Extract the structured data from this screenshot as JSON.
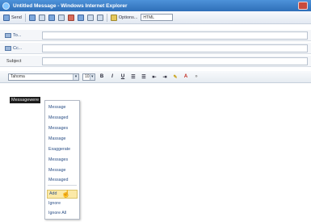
{
  "window": {
    "title": "Untitled Message - Windows Internet Explorer"
  },
  "toolbar": {
    "send_label": "Send",
    "options_label": "Options...",
    "format_value": "HTML"
  },
  "headers": {
    "to_label": "To...",
    "cc_label": "Cc...",
    "subject_label": "Subject"
  },
  "format_bar": {
    "font_value": "Tahoma",
    "size_value": "10",
    "bold": "B",
    "italic": "I",
    "underline": "U",
    "font_color": "A"
  },
  "body": {
    "selected_word": "Messagewere"
  },
  "context_menu": {
    "suggestions": [
      "Message",
      "Messaged",
      "Messages",
      "Massage",
      "Exaggerate",
      "Messages",
      "Message",
      "Messaged"
    ],
    "actions": [
      "Add",
      "Ignore",
      "Ignore All"
    ]
  }
}
